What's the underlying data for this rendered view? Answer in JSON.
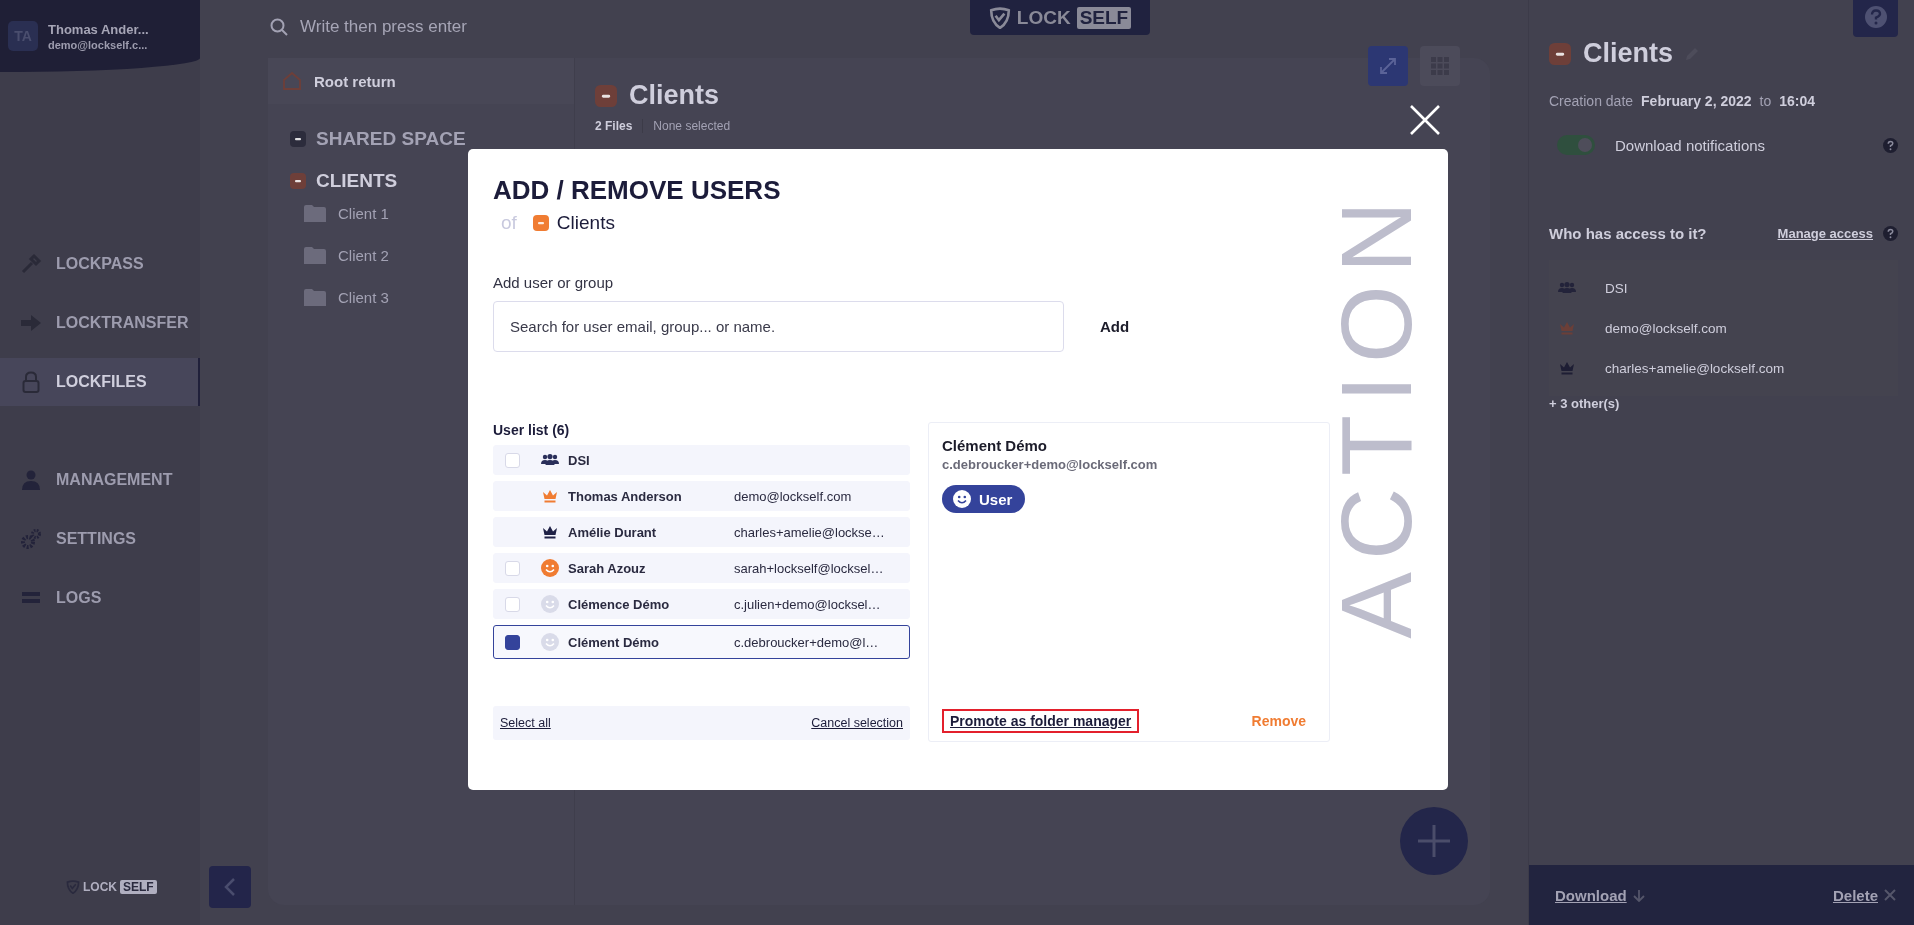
{
  "sidebar": {
    "user": {
      "initials": "TA",
      "name": "Thomas Ander...",
      "email": "demo@lockself.c..."
    },
    "nav_apps": [
      {
        "label": "LOCKPASS",
        "selected": false
      },
      {
        "label": "LOCKTRANSFER",
        "selected": false
      },
      {
        "label": "LOCKFILES",
        "selected": true
      }
    ],
    "nav_admin": [
      {
        "label": "MANAGEMENT",
        "selected": false
      },
      {
        "label": "SETTINGS",
        "selected": false
      },
      {
        "label": "LOGS",
        "selected": false
      }
    ],
    "logo": {
      "word": "LOCK",
      "badge": "SELF"
    }
  },
  "search": {
    "placeholder": "Write then press enter"
  },
  "top_logo": {
    "word": "LOCK",
    "badge": "SELF"
  },
  "tree": {
    "root": "Root return",
    "spaces": [
      {
        "label": "SHARED SPACE",
        "color": "#2c2c3c"
      },
      {
        "label": "CLIENTS",
        "color": "#6e3f39",
        "children": [
          {
            "label": "Client 1"
          },
          {
            "label": "Client 2"
          },
          {
            "label": "Client 3"
          }
        ]
      }
    ]
  },
  "folder": {
    "title": "Clients",
    "files": "2 Files",
    "selection": "None selected"
  },
  "modal": {
    "title": "ADD / REMOVE USERS",
    "of": "of",
    "folder": "Clients",
    "add_label": "Add user or group",
    "search_placeholder": "Search for user email, group... or name.",
    "add_button": "Add",
    "list_title": "User list (6)",
    "users": [
      {
        "kind": "group",
        "color": "#2a2f5a",
        "name": "DSI",
        "checked": false,
        "selected": false
      },
      {
        "kind": "crown",
        "color": "#f07c32",
        "name": "Thomas Anderson",
        "email": "demo@lockself.com",
        "selected": false
      },
      {
        "kind": "crown",
        "color": "#1f2146",
        "name": "Amélie Durant",
        "email": "charles+amelie@lockse…",
        "selected": false
      },
      {
        "kind": "smiley",
        "color": "#f07c32",
        "name": "Sarah Azouz",
        "email": "sarah+lockself@locksel…",
        "checked": false,
        "selected": false
      },
      {
        "kind": "smiley",
        "color": "#d9dbe9",
        "name": "Clémence Démo",
        "email": "c.julien+demo@locksel…",
        "checked": false,
        "selected": false
      },
      {
        "kind": "smiley",
        "color": "#d9dbe9",
        "name": "Clément Démo",
        "email": "c.debroucker+demo@l…",
        "checked": true,
        "selected": true
      }
    ],
    "select_all": "Select all",
    "cancel_selection": "Cancel selection",
    "detail": {
      "name": "Clément Démo",
      "email": "c.debroucker+demo@lockself.com",
      "role": "User",
      "promote": "Promote as folder manager",
      "promote_highlighted": true,
      "remove": "Remove"
    },
    "side_text": "ACTION"
  },
  "panel": {
    "title": "Clients",
    "created_label": "Creation date",
    "created_date": "February 2, 2022",
    "to": "to",
    "created_time": "16:04",
    "notifications": {
      "label": "Download notifications",
      "on": true
    },
    "access_title": "Who has access to it?",
    "manage_access": "Manage access",
    "access": [
      {
        "kind": "group",
        "color": "#23233a",
        "label": "DSI"
      },
      {
        "kind": "crown",
        "color": "#6b3f38",
        "label": "demo@lockself.com"
      },
      {
        "kind": "crown",
        "color": "#1e1e34",
        "label": "charles+amelie@lockself.com"
      }
    ],
    "others": "+ 3 other(s)"
  },
  "actions": {
    "download": "Download",
    "delete": "Delete"
  }
}
